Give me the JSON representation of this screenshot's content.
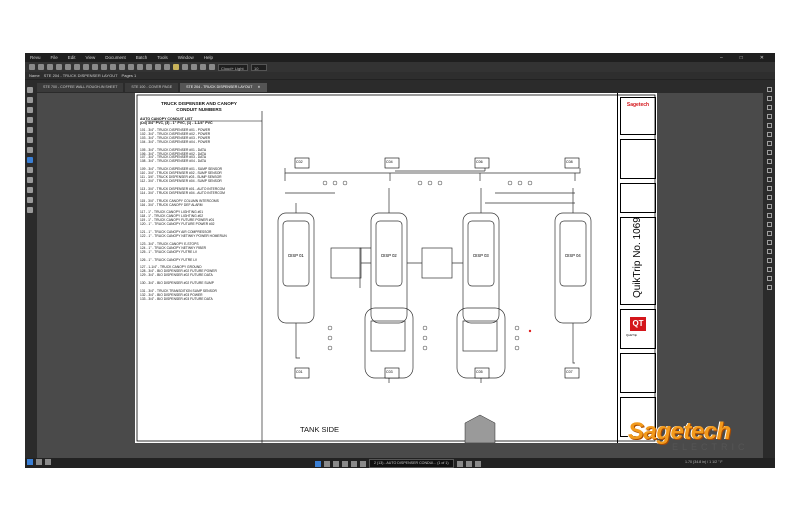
{
  "menu": [
    "Revu",
    "File",
    "Edit",
    "View",
    "Document",
    "Batch",
    "Tools",
    "Window",
    "Help"
  ],
  "toolbar": {
    "style_select": "Cloud+ Light",
    "size_select": "10"
  },
  "docname": {
    "label": "Name",
    "file": "STE 204 - TRUCK DISPENSER LAYOUT",
    "pages": "Pages 1"
  },
  "tabs": [
    {
      "label": "STE 700 - COFFEE WALL ROUGH-IN SHEET"
    },
    {
      "label": "STE 100 - COVER PAGE"
    },
    {
      "label": "STE 204 - TRUCK DISPENSER LAYOUT"
    }
  ],
  "status": {
    "page": "2 (13) - AUTO DISPENSER CONDUI... (1 of 1)",
    "coords": "1.70 (34.8 in) / 1 1/2 \" F"
  },
  "sheet": {
    "title_line1": "TRUCK DISPENSER AND CANOPY",
    "title_line2": "CONDUIT NUMBERS",
    "list_title1": "AUTO CANOPY CONDUIT LIST",
    "list_title2": "(D4) 3/4\" PVC, (3) - 1\" PVC, (1) - 1-1/4\" PVC",
    "conduits": [
      "101 - 3/4\" - TRUCK DISPENSER #01 - POWER",
      "102 - 3/4\" - TRUCK DISPENSER #02 - POWER",
      "103 - 3/4\" - TRUCK DISPENSER #03 - POWER",
      "104 - 3/4\" - TRUCK DISPENSER #04 - POWER",
      "105 - 3/4\" - TRUCK DISPENSER #01 - DATA",
      "106 - 3/4\" - TRUCK DISPENSER #02 - DATA",
      "107 - 3/4\" - TRUCK DISPENSER #03 - DATA",
      "108 - 3/4\" - TRUCK DISPENSER #04 - DATA",
      "109 - 3/4\" - TRUCK DISPENSER #01 - SUMP SENSOR",
      "110 - 3/4\" - TRUCK DISPENSER #02 - SUMP SENSOR",
      "111 - 3/4\" - TRUCK DISPENSER #03 - SUMP SENSOR",
      "112 - 3/4\" - TRUCK DISPENSER #04 - SUMP SENSOR",
      "113 - 3/4\" - TRUCK DISPENSER #01 - AUTO INTERCOM",
      "114 - 3/4\" - TRUCK DISPENSER #04 - AUTO INTERCOM",
      "115 - 3/4\" - TRUCK CANOPY COLUMN INTERCOMS",
      "116 - 3/4\" - TRUCK CANOPY DEF ALARM",
      "117 - 1\" - TRUCK CANOPY LIGHTING #01",
      "118 - 1\" - TRUCK CANOPY LIGHTING #02",
      "119 - 1\" - TRUCK CANOPY FUTURE POWER #01",
      "120 - 1\" - TRUCK CANOPY FUTURE POWER #02",
      "121 - 1\" - TRUCK CANOPY AIR COMPRESSOR",
      "122 - 1\" - TRUCK CANOPY NETWKY POWER HOMERUN",
      "123 - 3/4\" - TRUCK CANOPY E-STOPS",
      "124 - 1\" - TRUCK CANOPY NETWKY FIBER",
      "125 - 1\" - TRUCK CANOPY FUTRE LV",
      "126 - 1\" - TRUCK CANOPY FUTRE LV",
      "127 - 1-1/4\" - TRUCK CANOPY GROUND",
      "128 - 3/4\" - BIO DISPENSER #02 FUTURE POWER",
      "129 - 3/4\" - BIO DISPENSER #02 FUTURE DATA",
      "130 - 3/4\" - BIO DISPENSER #02 FUTURE SUMP",
      "131 - 3/4\" - TRUCK TRANSDITION SUMP SENSOR",
      "132 - 3/4\" - BIO DISPENSER #03 POWER",
      "133 - 3/4\" - BIO DISPENSER #03 FUTURE DATA",
      "134 - 3/4\" - BIO DISPENSER #03 FUTURE SUMP"
    ],
    "columns": [
      "C02",
      "C04",
      "C06",
      "C08"
    ],
    "ground_boxes": [
      "C01",
      "C03",
      "C05",
      "C07"
    ],
    "dispensers": [
      "DISP 01",
      "DISP 02",
      "DISP 03",
      "DISP 04"
    ],
    "tank_side": "TANK SIDE",
    "project": "QuikTrip No. 1069",
    "brand_logo": "QT",
    "brand_name": "QuikTrip",
    "company_stamp": "Sagetech"
  },
  "watermark": {
    "name": "Sagetech",
    "sub": "ELECTRIC"
  }
}
